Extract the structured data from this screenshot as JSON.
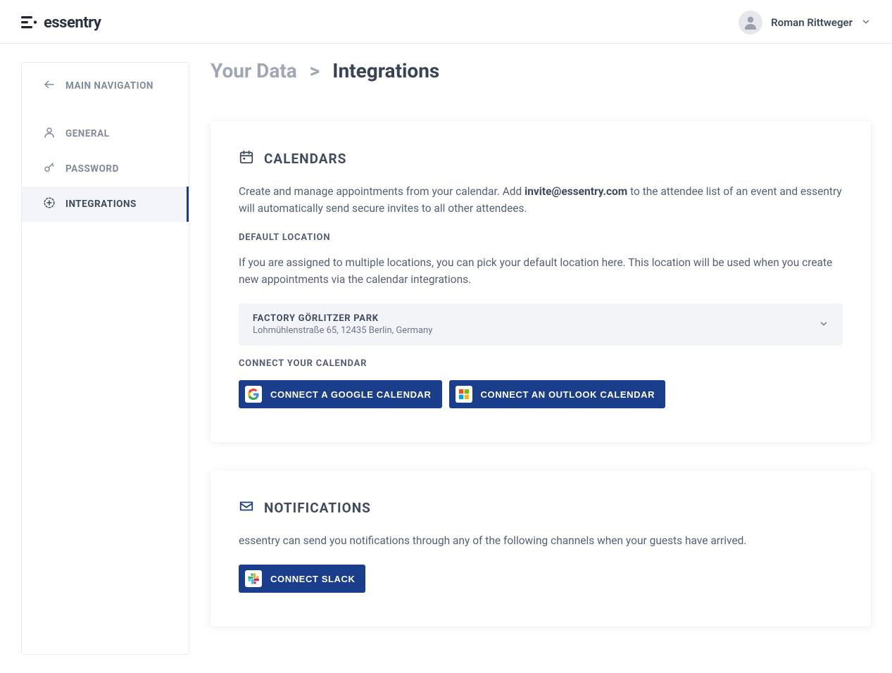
{
  "brand": "essentry",
  "user": {
    "name": "Roman Rittweger"
  },
  "sidebar": {
    "main_nav": "MAIN NAVIGATION",
    "general": "GENERAL",
    "password": "PASSWORD",
    "integrations": "INTEGRATIONS"
  },
  "breadcrumb": {
    "root": "Your Data",
    "sep": ">",
    "current": "Integrations"
  },
  "calendars": {
    "title": "CALENDARS",
    "desc_pre": "Create and manage appointments from your calendar. Add ",
    "desc_email": "invite@essentry.com",
    "desc_post": " to the attendee list of an event and essentry will automatically send secure invites to all other attendees.",
    "default_location_label": "DEFAULT LOCATION",
    "default_location_desc": "If you are assigned to multiple locations, you can pick your default location here. This location will be used when you create new appointments via the calendar integrations.",
    "location": {
      "name": "FACTORY GÖRLITZER PARK",
      "address": "Lohmühlenstraße 65, 12435 Berlin, Germany"
    },
    "connect_label": "CONNECT YOUR CALENDAR",
    "google_btn": "CONNECT A GOOGLE CALENDAR",
    "outlook_btn": "CONNECT AN OUTLOOK CALENDAR"
  },
  "notifications": {
    "title": "NOTIFICATIONS",
    "desc": "essentry can send you notifications through any of the following channels when your guests have arrived.",
    "slack_btn": "CONNECT SLACK"
  },
  "colors": {
    "primary": "#1a3e8c"
  }
}
